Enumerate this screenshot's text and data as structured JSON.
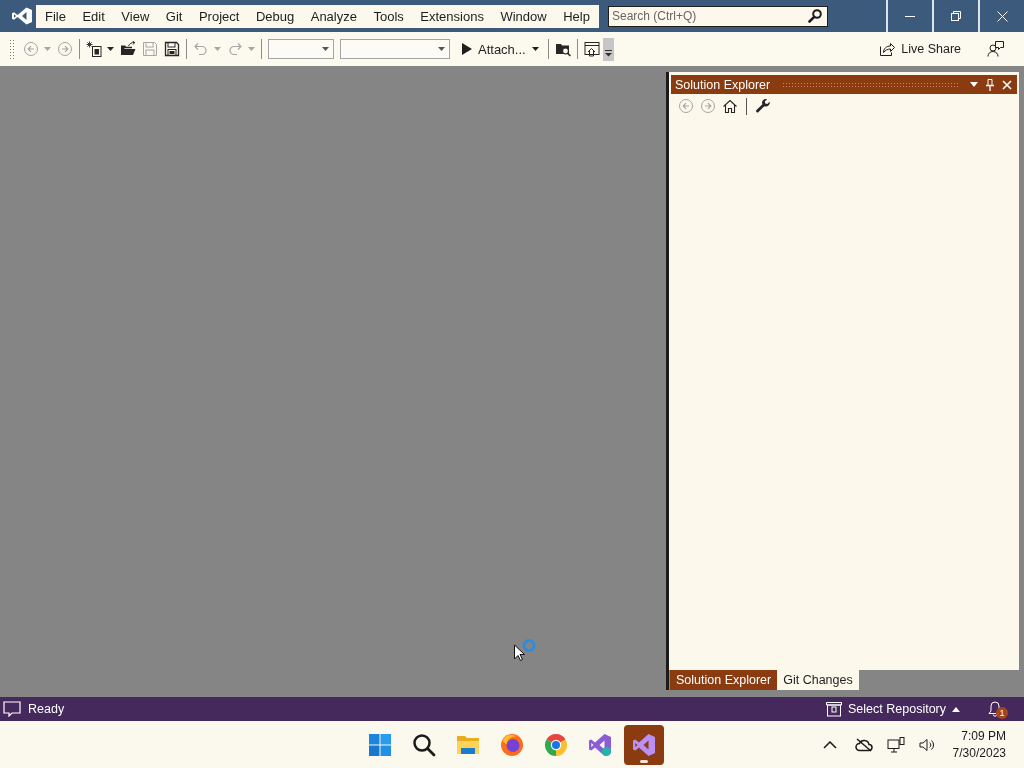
{
  "title_bar": {
    "menu": [
      {
        "label": "File"
      },
      {
        "label": "Edit"
      },
      {
        "label": "View"
      },
      {
        "label": "Git"
      },
      {
        "label": "Project"
      },
      {
        "label": "Debug"
      },
      {
        "label": "Analyze"
      },
      {
        "label": "Tools"
      },
      {
        "label": "Extensions"
      },
      {
        "label": "Window"
      },
      {
        "label": "Help"
      }
    ],
    "search": {
      "placeholder": "Search (Ctrl+Q)"
    }
  },
  "toolbar": {
    "groups": [
      [
        {
          "kind": "back",
          "disabled": true,
          "dropdown": true
        },
        {
          "kind": "forward",
          "disabled": true,
          "dropdown": false
        }
      ],
      [
        {
          "kind": "new_item",
          "disabled": false,
          "dropdown": true
        },
        {
          "kind": "open",
          "disabled": false,
          "dropdown": false
        },
        {
          "kind": "save",
          "disabled": true,
          "dropdown": false
        },
        {
          "kind": "save_all",
          "disabled": false,
          "dropdown": false
        }
      ],
      [
        {
          "kind": "undo",
          "disabled": true,
          "dropdown": true
        },
        {
          "kind": "redo",
          "disabled": true,
          "dropdown": true
        }
      ],
      [
        {
          "kind": "combo",
          "disabled": false
        },
        {
          "kind": "combo",
          "disabled": false
        },
        {
          "kind": "start",
          "label": "Attach...",
          "disabled": false,
          "dropdown": true
        }
      ],
      [
        {
          "kind": "find",
          "disabled": false,
          "dropdown": false
        }
      ],
      [
        {
          "kind": "window",
          "disabled": false,
          "dropdown": false
        }
      ]
    ],
    "live_share": {
      "label": "Live Share"
    }
  },
  "solution_explorer": {
    "title": "Solution Explorer",
    "toolbar": [
      [
        {
          "kind": "back",
          "disabled": true
        },
        {
          "kind": "forward",
          "disabled": true
        },
        {
          "kind": "home",
          "disabled": false
        }
      ],
      [
        {
          "kind": "wrench",
          "disabled": false
        }
      ]
    ],
    "tabs": [
      {
        "label": "Solution Explorer",
        "selected": true
      },
      {
        "label": "Git Changes",
        "selected": false
      }
    ]
  },
  "status_bar": {
    "text": "Ready",
    "repository": "Select Repository",
    "notifications": "1"
  },
  "taskbar": {
    "apps": [
      {
        "kind": "start",
        "selected": false
      },
      {
        "kind": "search",
        "selected": false
      },
      {
        "kind": "folder",
        "selected": false
      },
      {
        "kind": "swirl_browser",
        "selected": false
      },
      {
        "kind": "ring_browser",
        "selected": false
      },
      {
        "kind": "ide",
        "selected": false
      },
      {
        "kind": "ide_preview",
        "selected": true
      }
    ],
    "clock": {
      "time": "7:09 PM",
      "date": "7/30/2023"
    }
  }
}
